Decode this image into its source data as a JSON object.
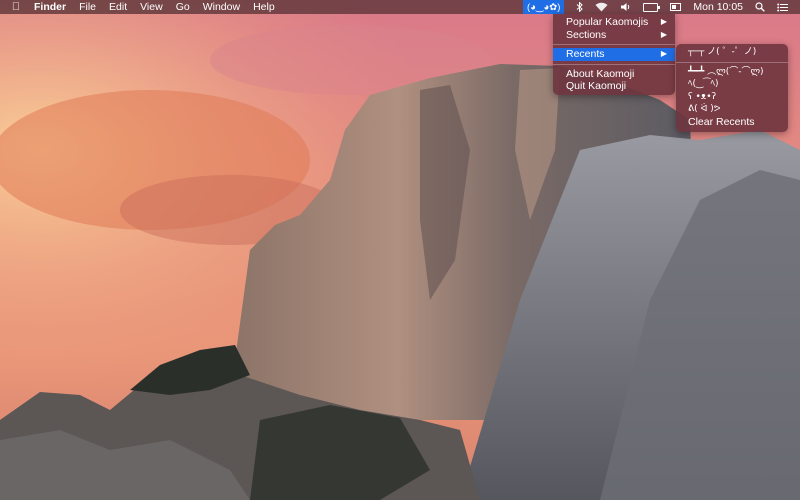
{
  "menubar": {
    "apple_icon": "apple-icon",
    "menus": [
      "Finder",
      "File",
      "Edit",
      "View",
      "Go",
      "Window",
      "Help"
    ],
    "status": {
      "kaomoji": "(◕‿◕✿)",
      "bluetooth_icon": "bluetooth-icon",
      "wifi_icon": "wifi-icon",
      "volume_icon": "volume-icon",
      "battery_icon": "battery-icon",
      "battery_level": 0.8,
      "display_icon": "display-icon",
      "clock": "Mon 10:05",
      "spotlight_icon": "spotlight-icon",
      "notification_icon": "notification-center-icon"
    }
  },
  "main_menu": {
    "items": [
      {
        "label": "Popular Kaomojis",
        "submenu": true
      },
      {
        "label": "Sections",
        "submenu": true
      },
      {
        "label": "Recents",
        "submenu": true,
        "highlighted": true
      },
      {
        "label": "About Kaomoji"
      },
      {
        "label": "Quit Kaomoji"
      }
    ],
    "highlight_color": "#1f6ee6"
  },
  "recents_menu": {
    "items": [
      "┬─┬ ノ( ゜-゜ノ)",
      "┻━┻ ︵ლ(⌒-⌒ლ)",
      "ﾍ(‿⁀ﾍ)",
      "ʕ •ᴥ•ʔ",
      "ᕕ( ᐛ )ᕗ"
    ],
    "clear_label": "Clear Recents"
  }
}
